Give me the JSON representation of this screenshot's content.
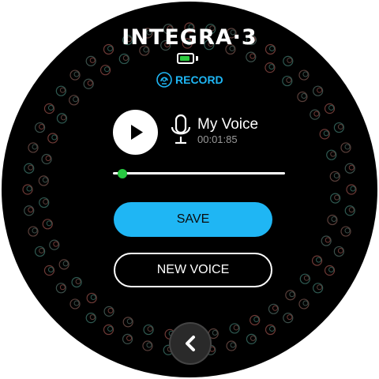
{
  "brand": {
    "title": "INTEGRA·3"
  },
  "battery": {
    "level": 0.85,
    "color": "#2ecc40"
  },
  "mode": {
    "label": "RECORD",
    "icon": "headset-voice-icon",
    "color": "#1fb6f4"
  },
  "player": {
    "play_icon": "play-icon",
    "mic_icon": "microphone-icon",
    "voice_name": "My Voice",
    "duration": "00:01:85",
    "progress": 0.03
  },
  "actions": {
    "save_label": "SAVE",
    "new_voice_label": "NEW VOICE",
    "save_color": "#1fb6f4"
  },
  "navigation": {
    "back_icon": "chevron-left-icon"
  }
}
